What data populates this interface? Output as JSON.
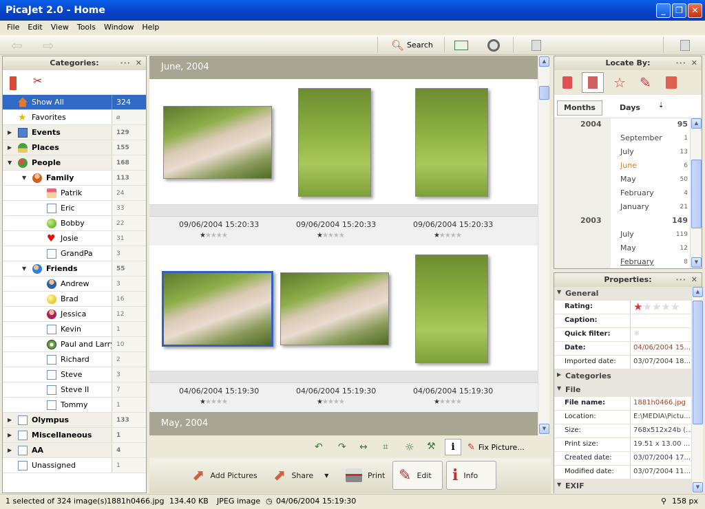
{
  "window": {
    "title": "PicaJet 2.0 - Home"
  },
  "menu": [
    "File",
    "Edit",
    "View",
    "Tools",
    "Window",
    "Help"
  ],
  "toolbar": {
    "search_label": "Search"
  },
  "categories": {
    "title": "Categories:",
    "items": [
      {
        "label": "Show All",
        "count": "324"
      },
      {
        "label": "Favorites",
        "count": ""
      },
      {
        "label": "Events",
        "count": "129"
      },
      {
        "label": "Places",
        "count": "155"
      },
      {
        "label": "People",
        "count": "168"
      },
      {
        "label": "Family",
        "count": "113"
      },
      {
        "label": "Patrik",
        "count": "24"
      },
      {
        "label": "Eric",
        "count": "33"
      },
      {
        "label": "Bobby",
        "count": "22"
      },
      {
        "label": "Josie",
        "count": "31"
      },
      {
        "label": "GrandPa",
        "count": "3"
      },
      {
        "label": "Friends",
        "count": "55"
      },
      {
        "label": "Andrew",
        "count": "3"
      },
      {
        "label": "Brad",
        "count": "16"
      },
      {
        "label": "Jessica",
        "count": "12"
      },
      {
        "label": "Kevin",
        "count": "1"
      },
      {
        "label": "Paul and Larry",
        "count": "10"
      },
      {
        "label": "Richard",
        "count": "2"
      },
      {
        "label": "Steve",
        "count": "3"
      },
      {
        "label": "Steve II",
        "count": "7"
      },
      {
        "label": "Tommy",
        "count": "1"
      },
      {
        "label": "Olympus",
        "count": "133"
      },
      {
        "label": "Miscellaneous",
        "count": "1"
      },
      {
        "label": "AA",
        "count": "4"
      },
      {
        "label": "Unassigned",
        "count": "1"
      }
    ]
  },
  "gallery": {
    "group1": {
      "month": "June, 2004",
      "dates": [
        "09/06/2004 15:20:33",
        "09/06/2004 15:20:33",
        "09/06/2004 15:20:33"
      ]
    },
    "group2": {
      "dates": [
        "04/06/2004 15:19:30",
        "04/06/2004 15:19:30",
        "04/06/2004 15:19:30"
      ]
    },
    "group3": {
      "month": "May, 2004"
    }
  },
  "editbar": {
    "fix_label": "Fix Picture..."
  },
  "actions": {
    "add": "Add Pictures",
    "share": "Share",
    "print": "Print",
    "edit": "Edit",
    "info": "Info"
  },
  "locate": {
    "title": "Locate By:",
    "tab_months": "Months",
    "tab_days": "Days",
    "years": [
      {
        "year": "2004",
        "count": "95"
      },
      {
        "year": "2003",
        "count": "149"
      }
    ],
    "months2004": [
      {
        "m": "September",
        "c": "1"
      },
      {
        "m": "July",
        "c": "13"
      },
      {
        "m": "June",
        "c": "6"
      },
      {
        "m": "May",
        "c": "50"
      },
      {
        "m": "February",
        "c": "4"
      },
      {
        "m": "January",
        "c": "21"
      }
    ],
    "months2003": [
      {
        "m": "July",
        "c": "119"
      },
      {
        "m": "May",
        "c": "12"
      },
      {
        "m": "February",
        "c": "8"
      }
    ]
  },
  "properties": {
    "title": "Properties:",
    "general": "General",
    "rating_label": "Rating:",
    "rating_value": 1,
    "caption_label": "Caption:",
    "quick_label": "Quick filter:",
    "date_label": "Date:",
    "date_value": "04/06/2004 15...",
    "imported_label": "Imported date:",
    "imported_value": "03/07/2004 18...",
    "categories": "Categories",
    "file": "File",
    "filename_label": "File name:",
    "filename_value": "1881h0466.jpg",
    "location_label": "Location:",
    "location_value": "E:\\MEDIA\\Pictu...",
    "size_label": "Size:",
    "size_value": "768x512x24b (...",
    "print_label": "Print size:",
    "print_value": "19.51 x 13.00 ...",
    "created_label": "Created date:",
    "created_value": "03/07/2004 17...",
    "modified_label": "Modified date:",
    "modified_value": "03/07/2004 11...",
    "exif": "EXIF"
  },
  "status": {
    "selection": "1 selected of 324 image(s)",
    "file": "1881h0466.jpg",
    "size": "134.40 KB",
    "type": "JPEG image",
    "date": "04/06/2004 15:19:30",
    "zoom": "158 px"
  }
}
